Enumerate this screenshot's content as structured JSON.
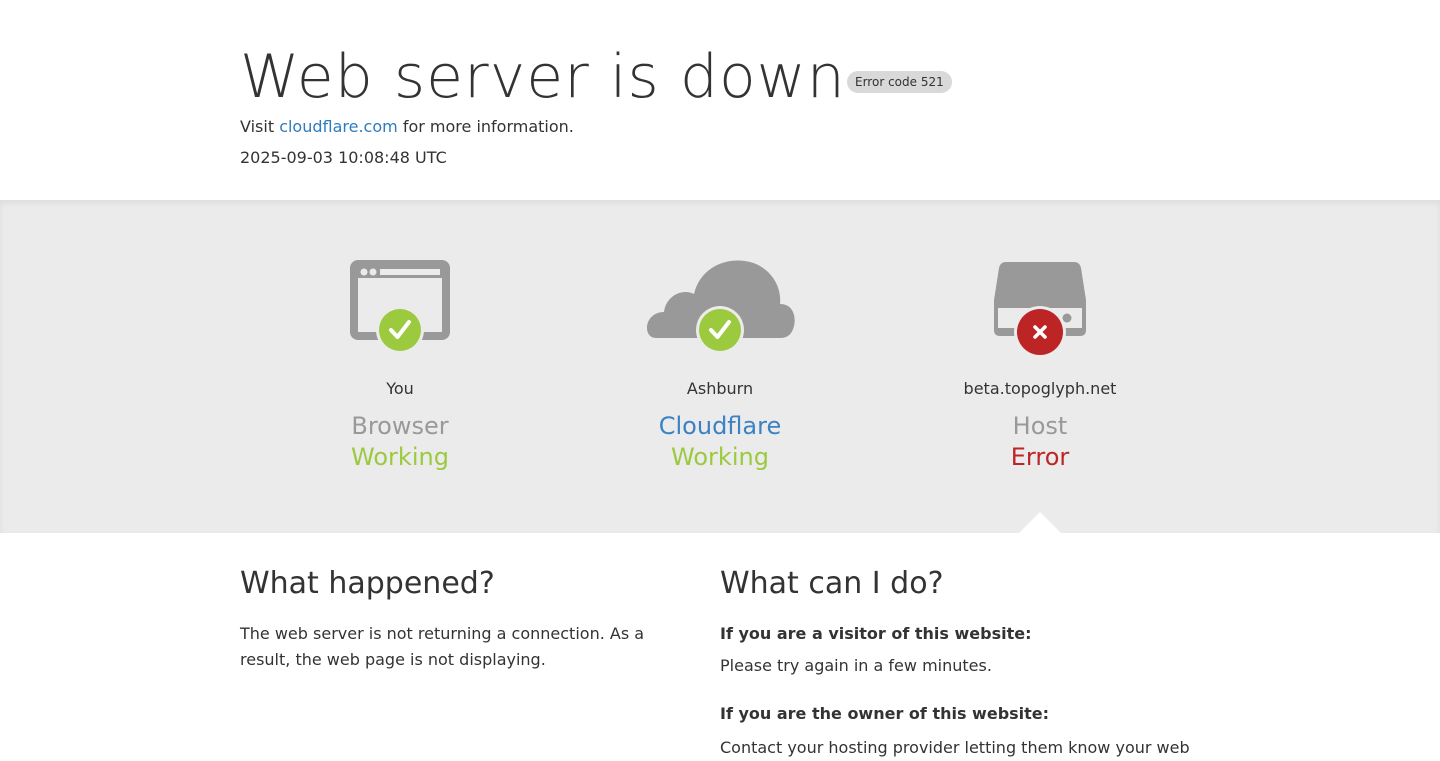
{
  "header": {
    "title": "Web server is down",
    "error_badge": "Error code 521",
    "visit_prefix": "Visit ",
    "visit_link": "cloudflare.com",
    "visit_suffix": " for more information.",
    "timestamp": "2025-09-03 10:08:48 UTC"
  },
  "nodes": [
    {
      "location": "You",
      "type": "Browser",
      "status": "Working",
      "status_kind": "ok",
      "icon": "browser-icon"
    },
    {
      "location": "Ashburn",
      "type": "Cloudflare",
      "status": "Working",
      "status_kind": "ok",
      "icon": "cloud-icon"
    },
    {
      "location": "beta.topoglyph.net",
      "type": "Host",
      "status": "Error",
      "status_kind": "error",
      "icon": "server-icon"
    }
  ],
  "what_happened": {
    "heading": "What happened?",
    "text": "The web server is not returning a connection. As a result, the web page is not displaying."
  },
  "what_can_i_do": {
    "heading": "What can I do?",
    "visitor_heading": "If you are a visitor of this website:",
    "visitor_text": "Please try again in a few minutes.",
    "owner_heading": "If you are the owner of this website:",
    "owner_text": "Contact your hosting provider letting them know your web"
  },
  "colors": {
    "ok": "#9bca3e",
    "error": "#bd2426",
    "link": "#2f7bbf",
    "icon_gray": "#999999"
  }
}
